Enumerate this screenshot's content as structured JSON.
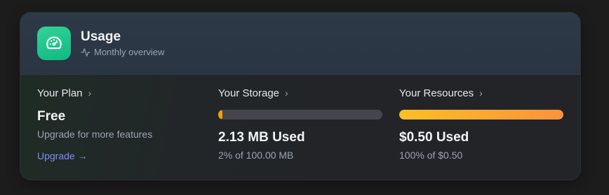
{
  "header": {
    "title": "Usage",
    "subtitle": "Monthly overview",
    "icon": "speedometer-icon",
    "subtitle_icon": "activity-icon"
  },
  "plan": {
    "title": "Your Plan",
    "chevron": "›",
    "name": "Free",
    "description": "Upgrade for more features",
    "upgrade_label": "Upgrade →"
  },
  "storage": {
    "title": "Your Storage",
    "chevron": "›",
    "progress_percent": 2,
    "used_label": "2.13 MB Used",
    "detail": "2% of 100.00 MB"
  },
  "resources": {
    "title": "Your Resources",
    "chevron": "›",
    "progress_percent": 100,
    "used_label": "$0.50 Used",
    "detail": "100% of $0.50"
  },
  "colors": {
    "accent_green": "#10b981",
    "link_blue": "#7c8cf8",
    "storage_bar": "#f59e0b",
    "resources_bar_start": "#fbbf24",
    "resources_bar_end": "#fb923c"
  }
}
